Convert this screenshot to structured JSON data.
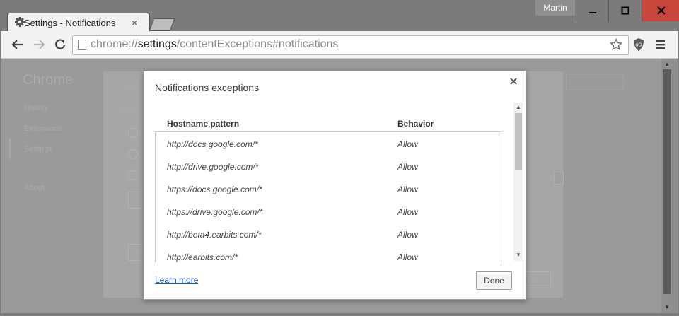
{
  "window": {
    "user_name": "Martin",
    "minimize_symbol": "–",
    "maximize_symbol": "▢",
    "close_symbol": "✕"
  },
  "tab": {
    "title": "Settings - Notifications",
    "icon": "gear-icon",
    "close_symbol": "×"
  },
  "toolbar": {
    "url_scheme": "chrome://",
    "url_host": "settings",
    "url_path": "/contentExceptions#notifications",
    "back_icon": "arrow-left-icon",
    "forward_icon": "arrow-right-icon",
    "reload_icon": "reload-icon",
    "star_icon": "star-icon",
    "extension_label": "uO",
    "menu_icon": "menu-icon"
  },
  "background_page": {
    "sidebar_title": "Chrome",
    "sidebar_items": [
      "History",
      "Extensions",
      "Settings",
      "About"
    ],
    "panel_title": "Conte",
    "section_label": "Notific",
    "section2_label": "Fullscr",
    "button_prefix": "M",
    "done_label": "Done"
  },
  "dialog": {
    "title": "Notifications exceptions",
    "close_symbol": "×",
    "columns": [
      "Hostname pattern",
      "Behavior"
    ],
    "rows": [
      {
        "host": "http://docs.google.com/*",
        "behavior": "Allow"
      },
      {
        "host": "http://drive.google.com/*",
        "behavior": "Allow"
      },
      {
        "host": "https://docs.google.com/*",
        "behavior": "Allow"
      },
      {
        "host": "https://drive.google.com/*",
        "behavior": "Allow"
      },
      {
        "host": "http://beta4.earbits.com/*",
        "behavior": "Allow"
      },
      {
        "host": "http://earbits.com/*",
        "behavior": "Allow"
      }
    ],
    "learn_more": "Learn more",
    "done_label": "Done"
  },
  "colors": {
    "link": "#1155cc",
    "close_button": "#c9463d"
  }
}
